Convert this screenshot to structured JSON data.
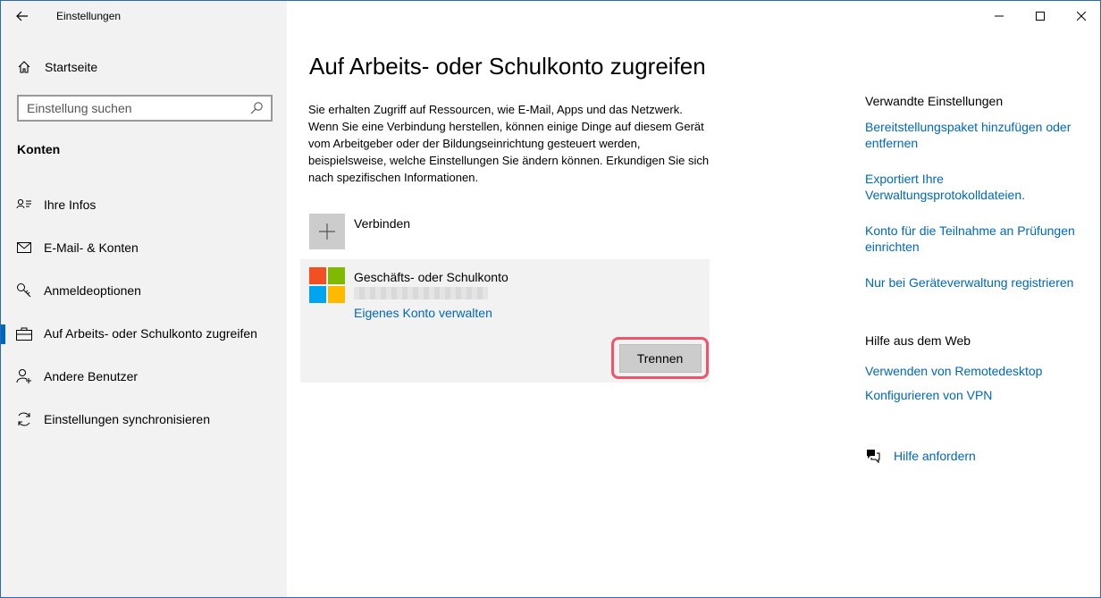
{
  "window": {
    "title": "Einstellungen"
  },
  "sidebar": {
    "home_label": "Startseite",
    "search_placeholder": "Einstellung suchen",
    "section_label": "Konten",
    "items": [
      {
        "label": "Ihre Infos",
        "icon": "person-card-icon"
      },
      {
        "label": "E-Mail- & Konten",
        "icon": "mail-icon"
      },
      {
        "label": "Anmeldeoptionen",
        "icon": "key-icon"
      },
      {
        "label": "Auf Arbeits- oder Schulkonto zugreifen",
        "icon": "briefcase-icon",
        "active": true
      },
      {
        "label": "Andere Benutzer",
        "icon": "add-person-icon"
      },
      {
        "label": "Einstellungen synchronisieren",
        "icon": "sync-icon"
      }
    ]
  },
  "main": {
    "title": "Auf Arbeits- oder Schulkonto zugreifen",
    "description": "Sie erhalten Zugriff auf Ressourcen, wie E-Mail, Apps und das Netzwerk. Wenn Sie eine Verbindung herstellen, können einige Dinge auf diesem Gerät vom Arbeitgeber oder der Bildungseinrichtung gesteuert werden, beispielsweise, welche Einstellungen Sie ändern können. Erkundigen Sie sich nach spezifischen Informationen.",
    "connect_label": "Verbinden",
    "account": {
      "name": "Geschäfts- oder Schulkonto",
      "manage_label": "Eigenes Konto verwalten",
      "disconnect_label": "Trennen"
    }
  },
  "related": {
    "heading": "Verwandte Einstellungen",
    "links": [
      "Bereitstellungspaket hinzufügen oder entfernen",
      "Exportiert Ihre Verwaltungsprotokolldateien.",
      "Konto für die Teilnahme an Prüfungen einrichten",
      "Nur bei Geräteverwaltung registrieren"
    ]
  },
  "help_web": {
    "heading": "Hilfe aus dem Web",
    "links": [
      "Verwenden von Remotedesktop",
      "Konfigurieren von VPN"
    ]
  },
  "get_help": {
    "label": "Hilfe anfordern"
  },
  "colors": {
    "accent": "#0067c0",
    "sidebar_bg": "#f2f2f2",
    "highlight": "#f0546a",
    "ms_red": "#f25022",
    "ms_green": "#7fba00",
    "ms_blue": "#00a4ef",
    "ms_yellow": "#ffb900"
  }
}
